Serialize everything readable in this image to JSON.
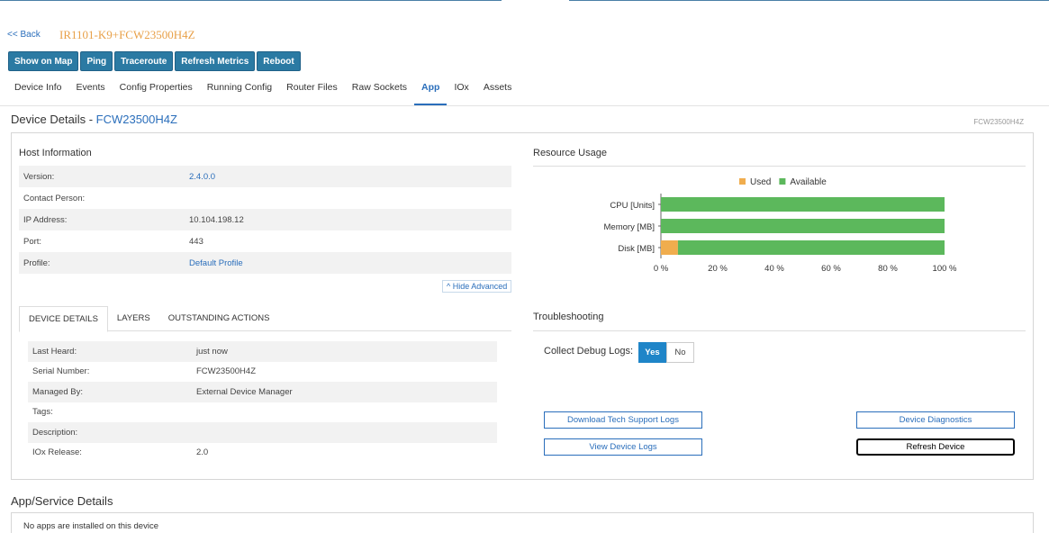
{
  "nav": {
    "back": "<< Back",
    "device_title": "IR1101-K9+FCW23500H4Z"
  },
  "actions": [
    "Show on Map",
    "Ping",
    "Traceroute",
    "Refresh Metrics",
    "Reboot"
  ],
  "tabs": [
    {
      "label": "Device Info"
    },
    {
      "label": "Events"
    },
    {
      "label": "Config Properties"
    },
    {
      "label": "Running Config"
    },
    {
      "label": "Router Files"
    },
    {
      "label": "Raw Sockets"
    },
    {
      "label": "App",
      "active": true
    },
    {
      "label": "IOx"
    },
    {
      "label": "Assets"
    }
  ],
  "device_details": {
    "heading": "Device Details - ",
    "serial": "FCW23500H4Z",
    "right_label": "FCW23500H4Z"
  },
  "host_info": {
    "title": "Host Information",
    "rows": [
      {
        "key": "Version:",
        "value": "2.4.0.0"
      },
      {
        "key": "Contact Person:",
        "value": ""
      },
      {
        "key": "IP Address:",
        "value": "10.104.198.12"
      },
      {
        "key": "Port:",
        "value": "443"
      },
      {
        "key": "Profile:",
        "value": "Default Profile"
      }
    ],
    "hide_advanced": "^ Hide Advanced"
  },
  "subtabs": [
    {
      "label": "DEVICE DETAILS",
      "active": true
    },
    {
      "label": "LAYERS"
    },
    {
      "label": "OUTSTANDING ACTIONS"
    }
  ],
  "details_rows": [
    {
      "key": "Last Heard:",
      "value": "just now"
    },
    {
      "key": "Serial Number:",
      "value": "FCW23500H4Z"
    },
    {
      "key": "Managed By:",
      "value": "External Device Manager"
    },
    {
      "key": "Tags:",
      "value": ""
    },
    {
      "key": "Description:",
      "value": ""
    },
    {
      "key": "IOx Release:",
      "value": "2.0"
    }
  ],
  "resource_usage": {
    "title": "Resource Usage",
    "chart_data": {
      "type": "bar",
      "orientation": "horizontal",
      "stacked": true,
      "categories": [
        "CPU [Units]",
        "Memory [MB]",
        "Disk [MB]"
      ],
      "series": [
        {
          "name": "Used",
          "color": "#f0ad4e",
          "values": [
            0,
            0,
            6
          ]
        },
        {
          "name": "Available",
          "color": "#5cb85c",
          "values": [
            100,
            100,
            94
          ]
        }
      ],
      "x_ticks": [
        "0 %",
        "20 %",
        "40 %",
        "60 %",
        "80 %",
        "100 %"
      ],
      "xlim": [
        0,
        100
      ],
      "legend": "top-center"
    }
  },
  "troubleshooting": {
    "title": "Troubleshooting",
    "collect_label": "Collect Debug Logs:",
    "yes": "Yes",
    "no": "No",
    "download_logs": "Download Tech Support Logs",
    "view_logs": "View Device Logs",
    "diagnostics": "Device Diagnostics",
    "refresh": "Refresh Device"
  },
  "apps": {
    "title": "App/Service Details",
    "empty": "No apps are installed on this device"
  }
}
